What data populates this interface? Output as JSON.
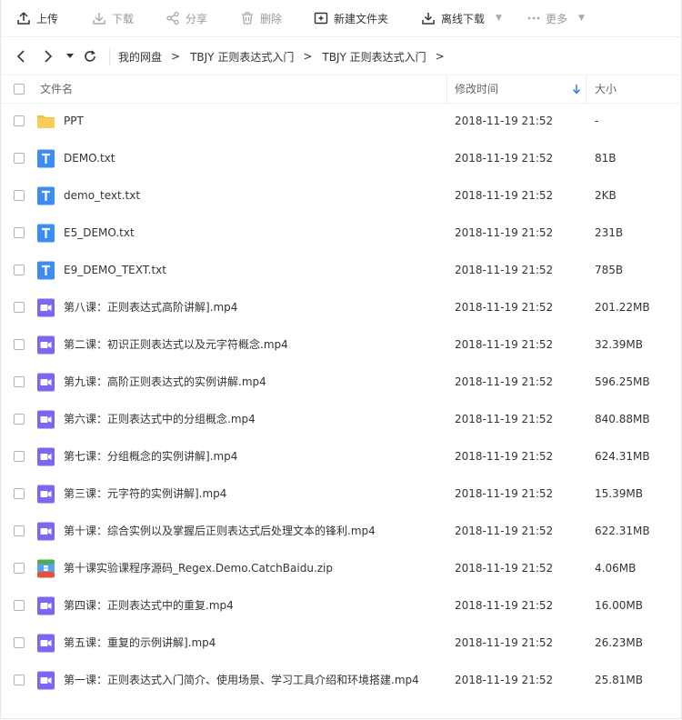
{
  "colors": {
    "folder": "#f6c14b",
    "txt_icon": "#3b8cf5",
    "video_icon": "#7b68ee",
    "sort_arrow": "#2f7ee8"
  },
  "toolbar": {
    "upload": "上传",
    "download": "下载",
    "share": "分享",
    "delete": "删除",
    "new_folder": "新建文件夹",
    "offline_download": "离线下载",
    "more": "更多"
  },
  "breadcrumb": {
    "items": [
      "我的网盘",
      "TBJY 正则表达式入门",
      "TBJY 正则表达式入门"
    ],
    "separator": ">"
  },
  "table": {
    "headers": {
      "name": "文件名",
      "modified": "修改时间",
      "size": "大小"
    },
    "rows": [
      {
        "icon": "folder-icon",
        "name": "PPT",
        "time": "2018-11-19 21:52",
        "size": "-"
      },
      {
        "icon": "txt-file-icon",
        "name": "DEMO.txt",
        "time": "2018-11-19 21:52",
        "size": "81B"
      },
      {
        "icon": "txt-file-icon",
        "name": "demo_text.txt",
        "time": "2018-11-19 21:52",
        "size": "2KB"
      },
      {
        "icon": "txt-file-icon",
        "name": "E5_DEMO.txt",
        "time": "2018-11-19 21:52",
        "size": "231B"
      },
      {
        "icon": "txt-file-icon",
        "name": "E9_DEMO_TEXT.txt",
        "time": "2018-11-19 21:52",
        "size": "785B"
      },
      {
        "icon": "video-file-icon",
        "name": "第八课：正则表达式高阶讲解].mp4",
        "time": "2018-11-19 21:52",
        "size": "201.22MB"
      },
      {
        "icon": "video-file-icon",
        "name": "第二课：初识正则表达式以及元字符概念.mp4",
        "time": "2018-11-19 21:52",
        "size": "32.39MB"
      },
      {
        "icon": "video-file-icon",
        "name": "第九课：高阶正则表达式的实例讲解.mp4",
        "time": "2018-11-19 21:52",
        "size": "596.25MB"
      },
      {
        "icon": "video-file-icon",
        "name": "第六课：正则表达式中的分组概念.mp4",
        "time": "2018-11-19 21:52",
        "size": "840.88MB"
      },
      {
        "icon": "video-file-icon",
        "name": "第七课：分组概念的实例讲解].mp4",
        "time": "2018-11-19 21:52",
        "size": "624.31MB"
      },
      {
        "icon": "video-file-icon",
        "name": "第三课：元字符的实例讲解].mp4",
        "time": "2018-11-19 21:52",
        "size": "15.39MB"
      },
      {
        "icon": "video-file-icon",
        "name": "第十课：综合实例以及掌握后正则表达式后处理文本的锋利.mp4",
        "time": "2018-11-19 21:52",
        "size": "622.31MB"
      },
      {
        "icon": "zip-file-icon",
        "name": "第十课实验课程序源码_Regex.Demo.CatchBaidu.zip",
        "time": "2018-11-19 21:52",
        "size": "4.06MB"
      },
      {
        "icon": "video-file-icon",
        "name": "第四课：正则表达式中的重复.mp4",
        "time": "2018-11-19 21:52",
        "size": "16.00MB"
      },
      {
        "icon": "video-file-icon",
        "name": "第五课：重复的示例讲解].mp4",
        "time": "2018-11-19 21:52",
        "size": "26.23MB"
      },
      {
        "icon": "video-file-icon",
        "name": "第一课：正则表达式入门简介、使用场景、学习工具介绍和环境搭建.mp4",
        "time": "2018-11-19 21:52",
        "size": "25.81MB"
      }
    ]
  }
}
